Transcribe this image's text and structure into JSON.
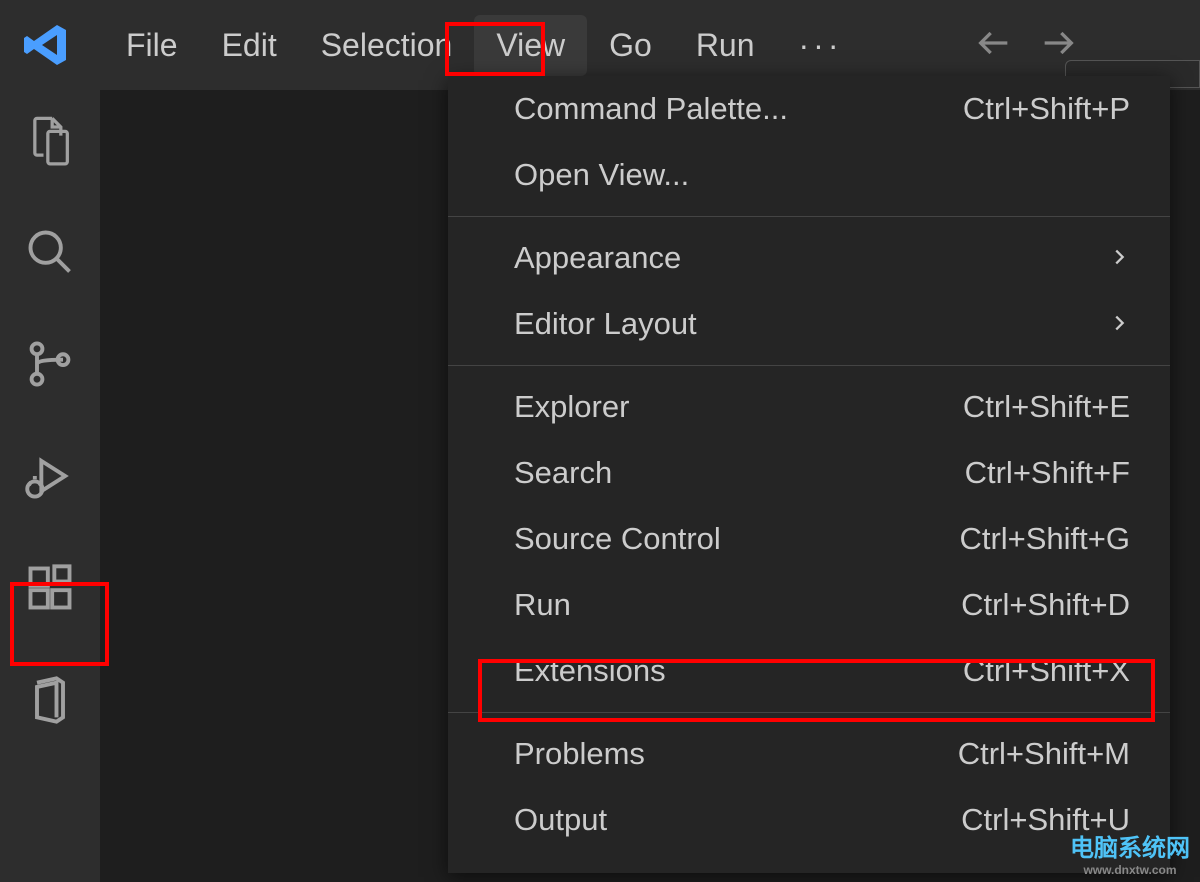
{
  "menubar": {
    "file": "File",
    "edit": "Edit",
    "selection": "Selection",
    "view": "View",
    "go": "Go",
    "run": "Run",
    "overflow": "···"
  },
  "dropdown": {
    "command_palette": {
      "label": "Command Palette...",
      "shortcut": "Ctrl+Shift+P"
    },
    "open_view": {
      "label": "Open View..."
    },
    "appearance": {
      "label": "Appearance"
    },
    "editor_layout": {
      "label": "Editor Layout"
    },
    "explorer": {
      "label": "Explorer",
      "shortcut": "Ctrl+Shift+E"
    },
    "search": {
      "label": "Search",
      "shortcut": "Ctrl+Shift+F"
    },
    "source_control": {
      "label": "Source Control",
      "shortcut": "Ctrl+Shift+G"
    },
    "run": {
      "label": "Run",
      "shortcut": "Ctrl+Shift+D"
    },
    "extensions": {
      "label": "Extensions",
      "shortcut": "Ctrl+Shift+X"
    },
    "problems": {
      "label": "Problems",
      "shortcut": "Ctrl+Shift+M"
    },
    "output": {
      "label": "Output",
      "shortcut": "Ctrl+Shift+U"
    }
  },
  "watermark": {
    "main": "电脑系统网",
    "sub": "www.dnxtw.com"
  }
}
